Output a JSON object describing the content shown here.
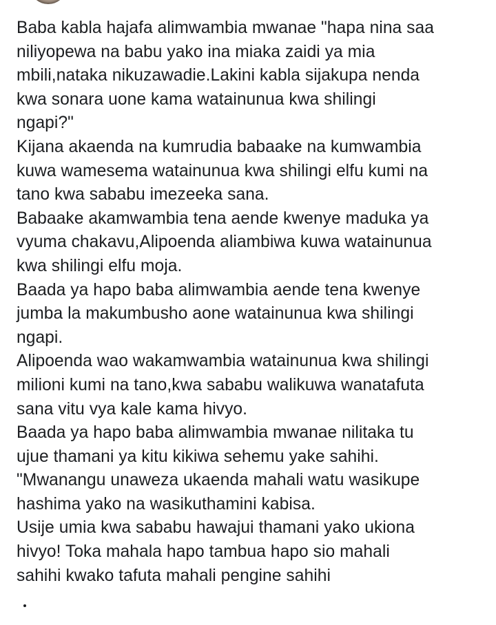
{
  "post": {
    "lines": [
      "Baba kabla hajafa alimwambia mwanae \"hapa nina saa",
      "niliyopewa na babu yako ina miaka zaidi ya mia",
      "mbili,nataka nikuzawadie.Lakini kabla sijakupa nenda",
      "kwa sonara uone kama watainunua kwa shilingi",
      "ngapi?\"",
      "Kijana akaenda na kumrudia babaake na kumwambia",
      "kuwa wamesema watainunua kwa shilingi elfu kumi na",
      "tano kwa sababu imezeeka sana.",
      "Babaake akamwambia tena aende kwenye maduka ya",
      "vyuma chakavu,Alipoenda aliambiwa kuwa watainunua",
      "kwa shilingi elfu moja.",
      "Baada ya hapo baba alimwambia aende tena kwenye",
      "jumba la makumbusho aone watainunua kwa shilingi",
      "ngapi.",
      "Alipoenda wao wakamwambia watainunua kwa shilingi",
      "milioni kumi na tano,kwa sababu walikuwa wanatafuta",
      "sana vitu vya kale kama hivyo.",
      "Baada ya hapo baba alimwambia mwanae nilitaka tu",
      "ujue thamani ya kitu kikiwa sehemu yake sahihi.",
      "\"Mwanangu unaweza ukaenda mahali watu wasikupe",
      "hashima yako na wasikuthamini kabisa.",
      "Usije umia kwa sababu hawajui thamani yako ukiona",
      "hivyo! Toka mahala hapo tambua hapo sio mahali",
      "sahihi kwako tafuta mahali pengine sahihi"
    ]
  },
  "colors": {
    "background": "#ffffff",
    "text": "#1c1e21"
  },
  "icons": {
    "avatar": "profile-avatar-icon"
  }
}
